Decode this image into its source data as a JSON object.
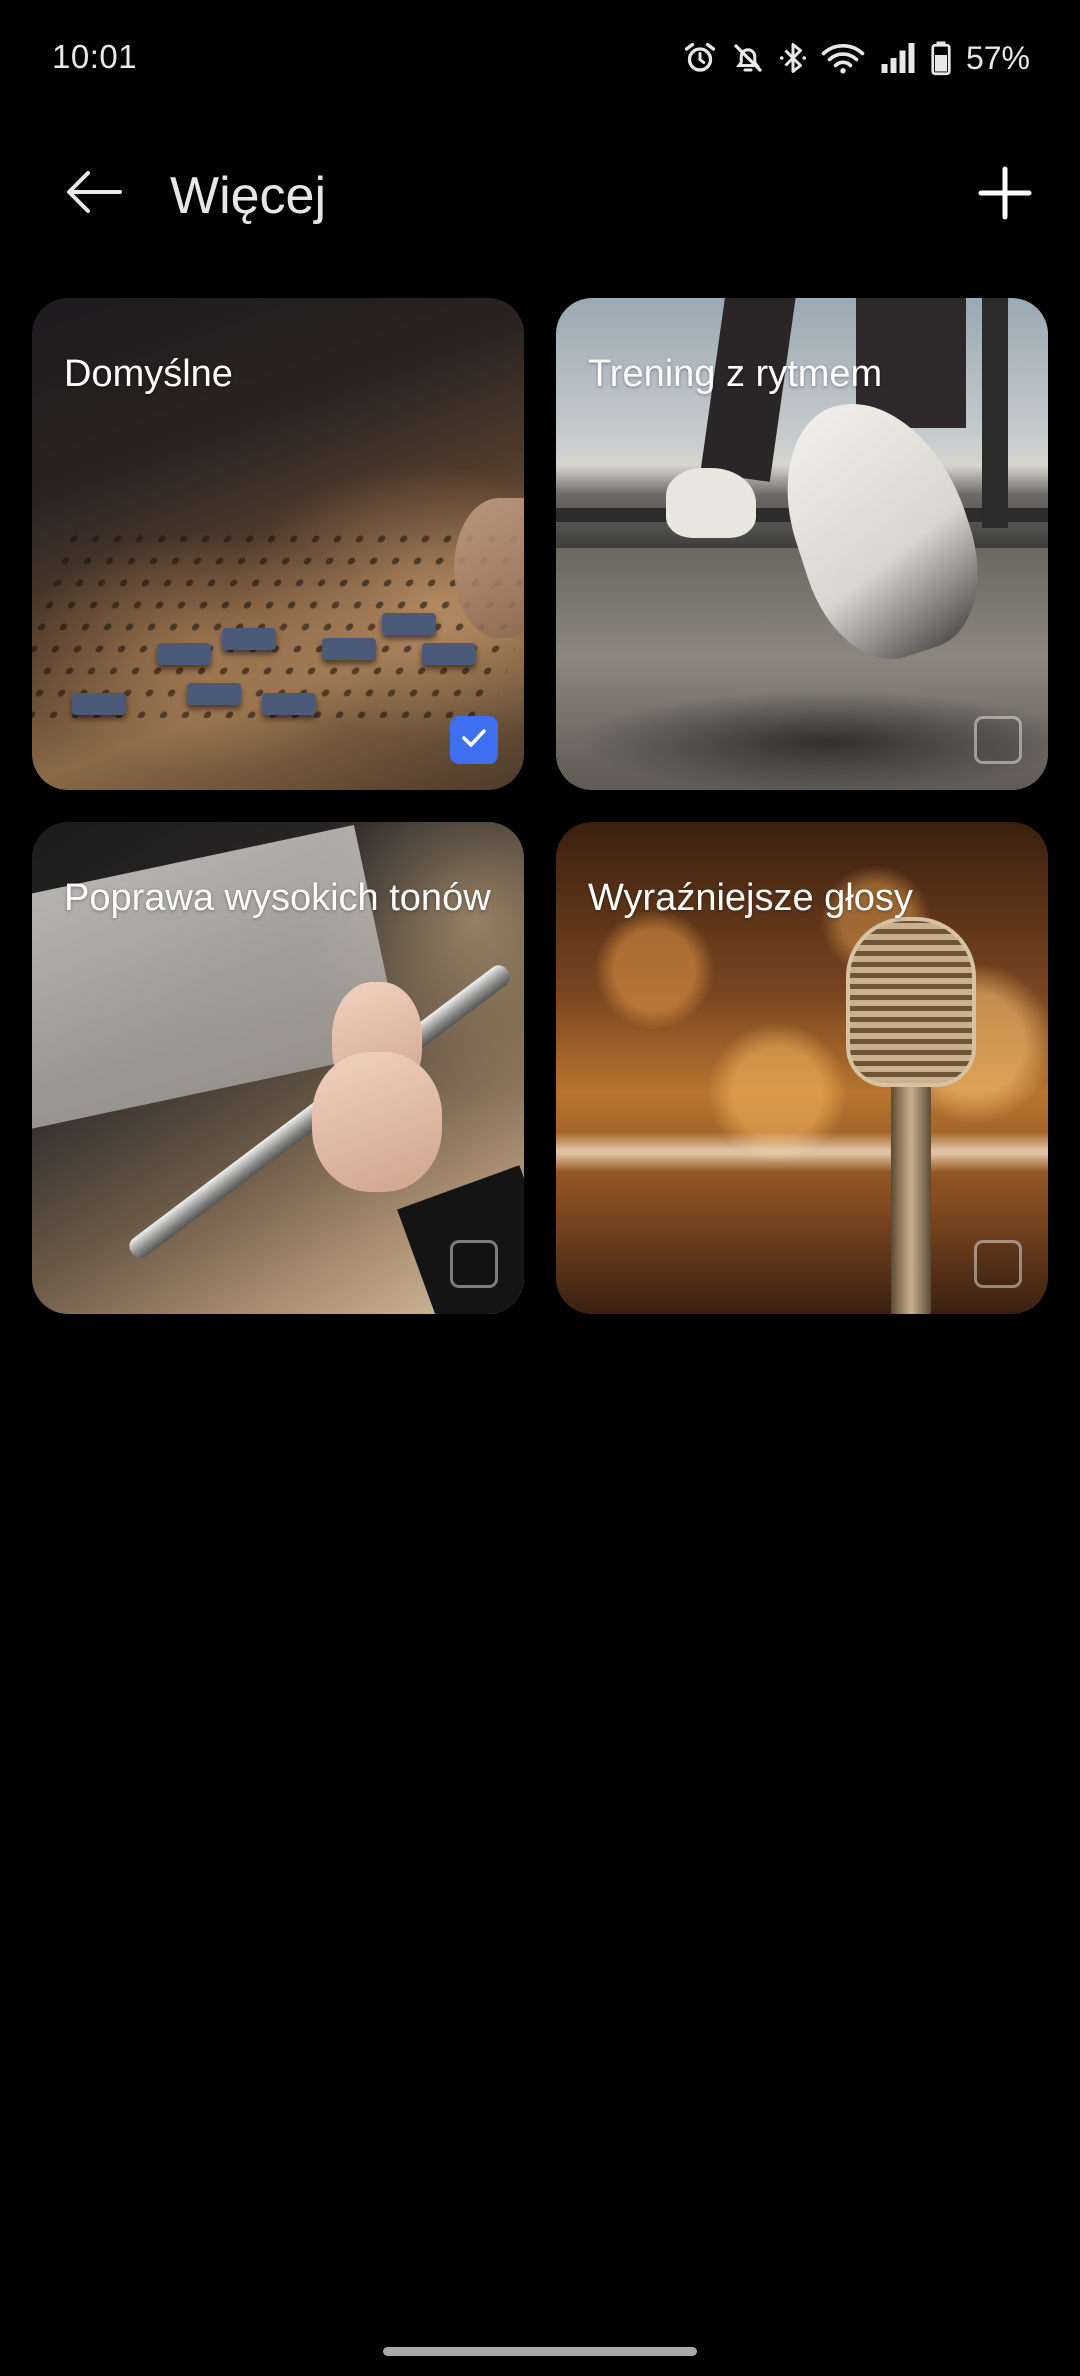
{
  "status_bar": {
    "time": "10:01",
    "icons": [
      "alarm-icon",
      "notifications-off-icon",
      "bluetooth-icon",
      "wifi-icon",
      "signal-icon",
      "battery-icon"
    ],
    "battery_percent": "57%"
  },
  "header": {
    "title": "Więcej",
    "back_icon": "back-arrow-icon",
    "add_icon": "plus-icon"
  },
  "cards": [
    {
      "title": "Domyślne",
      "checked": true,
      "image": "mixing-console-photo"
    },
    {
      "title": "Trening z rytmem",
      "checked": false,
      "image": "treadmill-runner-photo"
    },
    {
      "title": "Poprawa wysokich tonów",
      "checked": false,
      "image": "flute-player-photo"
    },
    {
      "title": "Wyraźniejsze głosy",
      "checked": false,
      "image": "vintage-microphone-photo"
    }
  ],
  "colors": {
    "background": "#000000",
    "accent": "#3d6ff0",
    "text": "#ffffff"
  }
}
